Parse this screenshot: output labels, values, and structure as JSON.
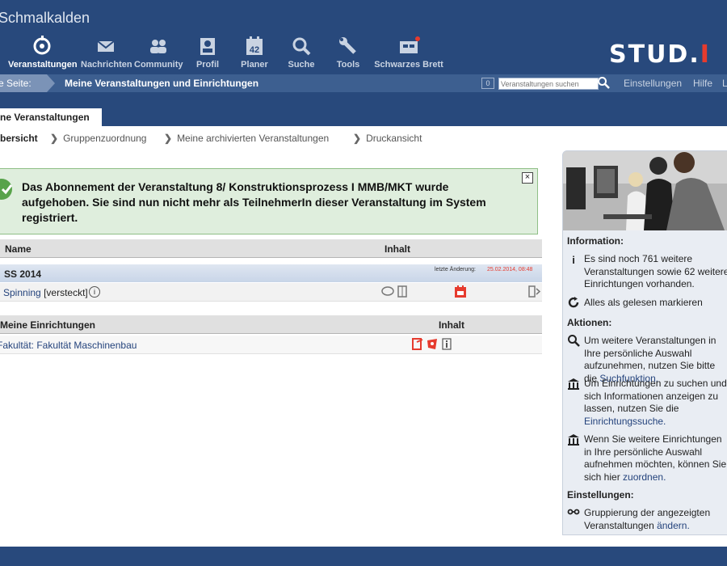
{
  "site": {
    "title": "Schmalkalden",
    "logo_main": "STUD.",
    "logo_accent": "I"
  },
  "nav": [
    {
      "label": "Veranstaltungen",
      "icon": "seminar-icon",
      "active": true
    },
    {
      "label": "Nachrichten",
      "icon": "mail-icon"
    },
    {
      "label": "Community",
      "icon": "community-icon"
    },
    {
      "label": "Profil",
      "icon": "profile-icon"
    },
    {
      "label": "Planer",
      "icon": "calendar-icon",
      "badge": "42"
    },
    {
      "label": "Suche",
      "icon": "search-icon"
    },
    {
      "label": "Tools",
      "icon": "wrench-icon"
    },
    {
      "label": "Schwarzes Brett",
      "icon": "board-icon"
    }
  ],
  "breadcrumb": {
    "label": "e Seite:",
    "current": "Meine Veranstaltungen und Einrichtungen"
  },
  "topbar": {
    "clip_count": "0",
    "search_placeholder": "Veranstaltungen suchen",
    "settings": "Einstellungen",
    "help": "Hilfe",
    "more": "L"
  },
  "tab": {
    "label": "ne Veranstaltungen"
  },
  "subnav": [
    {
      "label": "bersicht",
      "active": true
    },
    {
      "label": "Gruppenzuordnung"
    },
    {
      "label": "Meine archivierten Veranstaltungen"
    },
    {
      "label": "Druckansicht"
    }
  ],
  "message": {
    "text_part1": "Das Abonnement der Veranstaltung 8/ ",
    "text_bold": "Konstruktionsprozess I MMB/MKT",
    "text_part2": " wurde aufgehoben. Sie sind nun nicht mehr als TeilnehmerIn dieser Veranstaltung im System registriert.",
    "close": "×"
  },
  "courses": {
    "col_name": "Name",
    "col_content": "Inhalt",
    "semester": "SS 2014",
    "last_change_label": "letzte Änderung:",
    "last_change_value": "25.02.2014, 08:48",
    "row": {
      "title": "Spinning",
      "note": "[versteckt]"
    }
  },
  "institutes": {
    "col_name": "Meine Einrichtungen",
    "col_content": "Inhalt",
    "row": {
      "title": "Fakultät: Fakultät Maschinenbau"
    }
  },
  "sidebar": {
    "info_heading": "Information:",
    "info_text": "Es sind noch 761 weitere Veranstaltungen sowie 62 weitere Einrichtungen vorhanden.",
    "mark_read": "Alles als gelesen markieren",
    "actions_heading": "Aktionen:",
    "action1_text": "Um weitere Veranstaltungen in Ihre persönliche Auswahl aufzunehmen, nutzen Sie bitte die ",
    "action1_link": "Suchfunktion.",
    "action2_text": "Um Einrichtungen zu suchen und sich Informationen anzeigen zu lassen, nutzen Sie die ",
    "action2_link": "Einrichtungssuche.",
    "action3_text": "Wenn Sie weitere Einrichtungen in Ihre persönliche Auswahl aufnehmen möchten, können Sie sich hier ",
    "action3_link": "zuordnen.",
    "settings_heading": "Einstellungen:",
    "settings_text": "Gruppierung der angezeigten Veranstaltungen ",
    "settings_link": "ändern."
  },
  "colors": {
    "header": "#28497c",
    "crumbbar": "#3d5f90",
    "accent_red": "#e63b2e",
    "success_bg": "#dfeedd",
    "success_border": "#8fbf86"
  }
}
